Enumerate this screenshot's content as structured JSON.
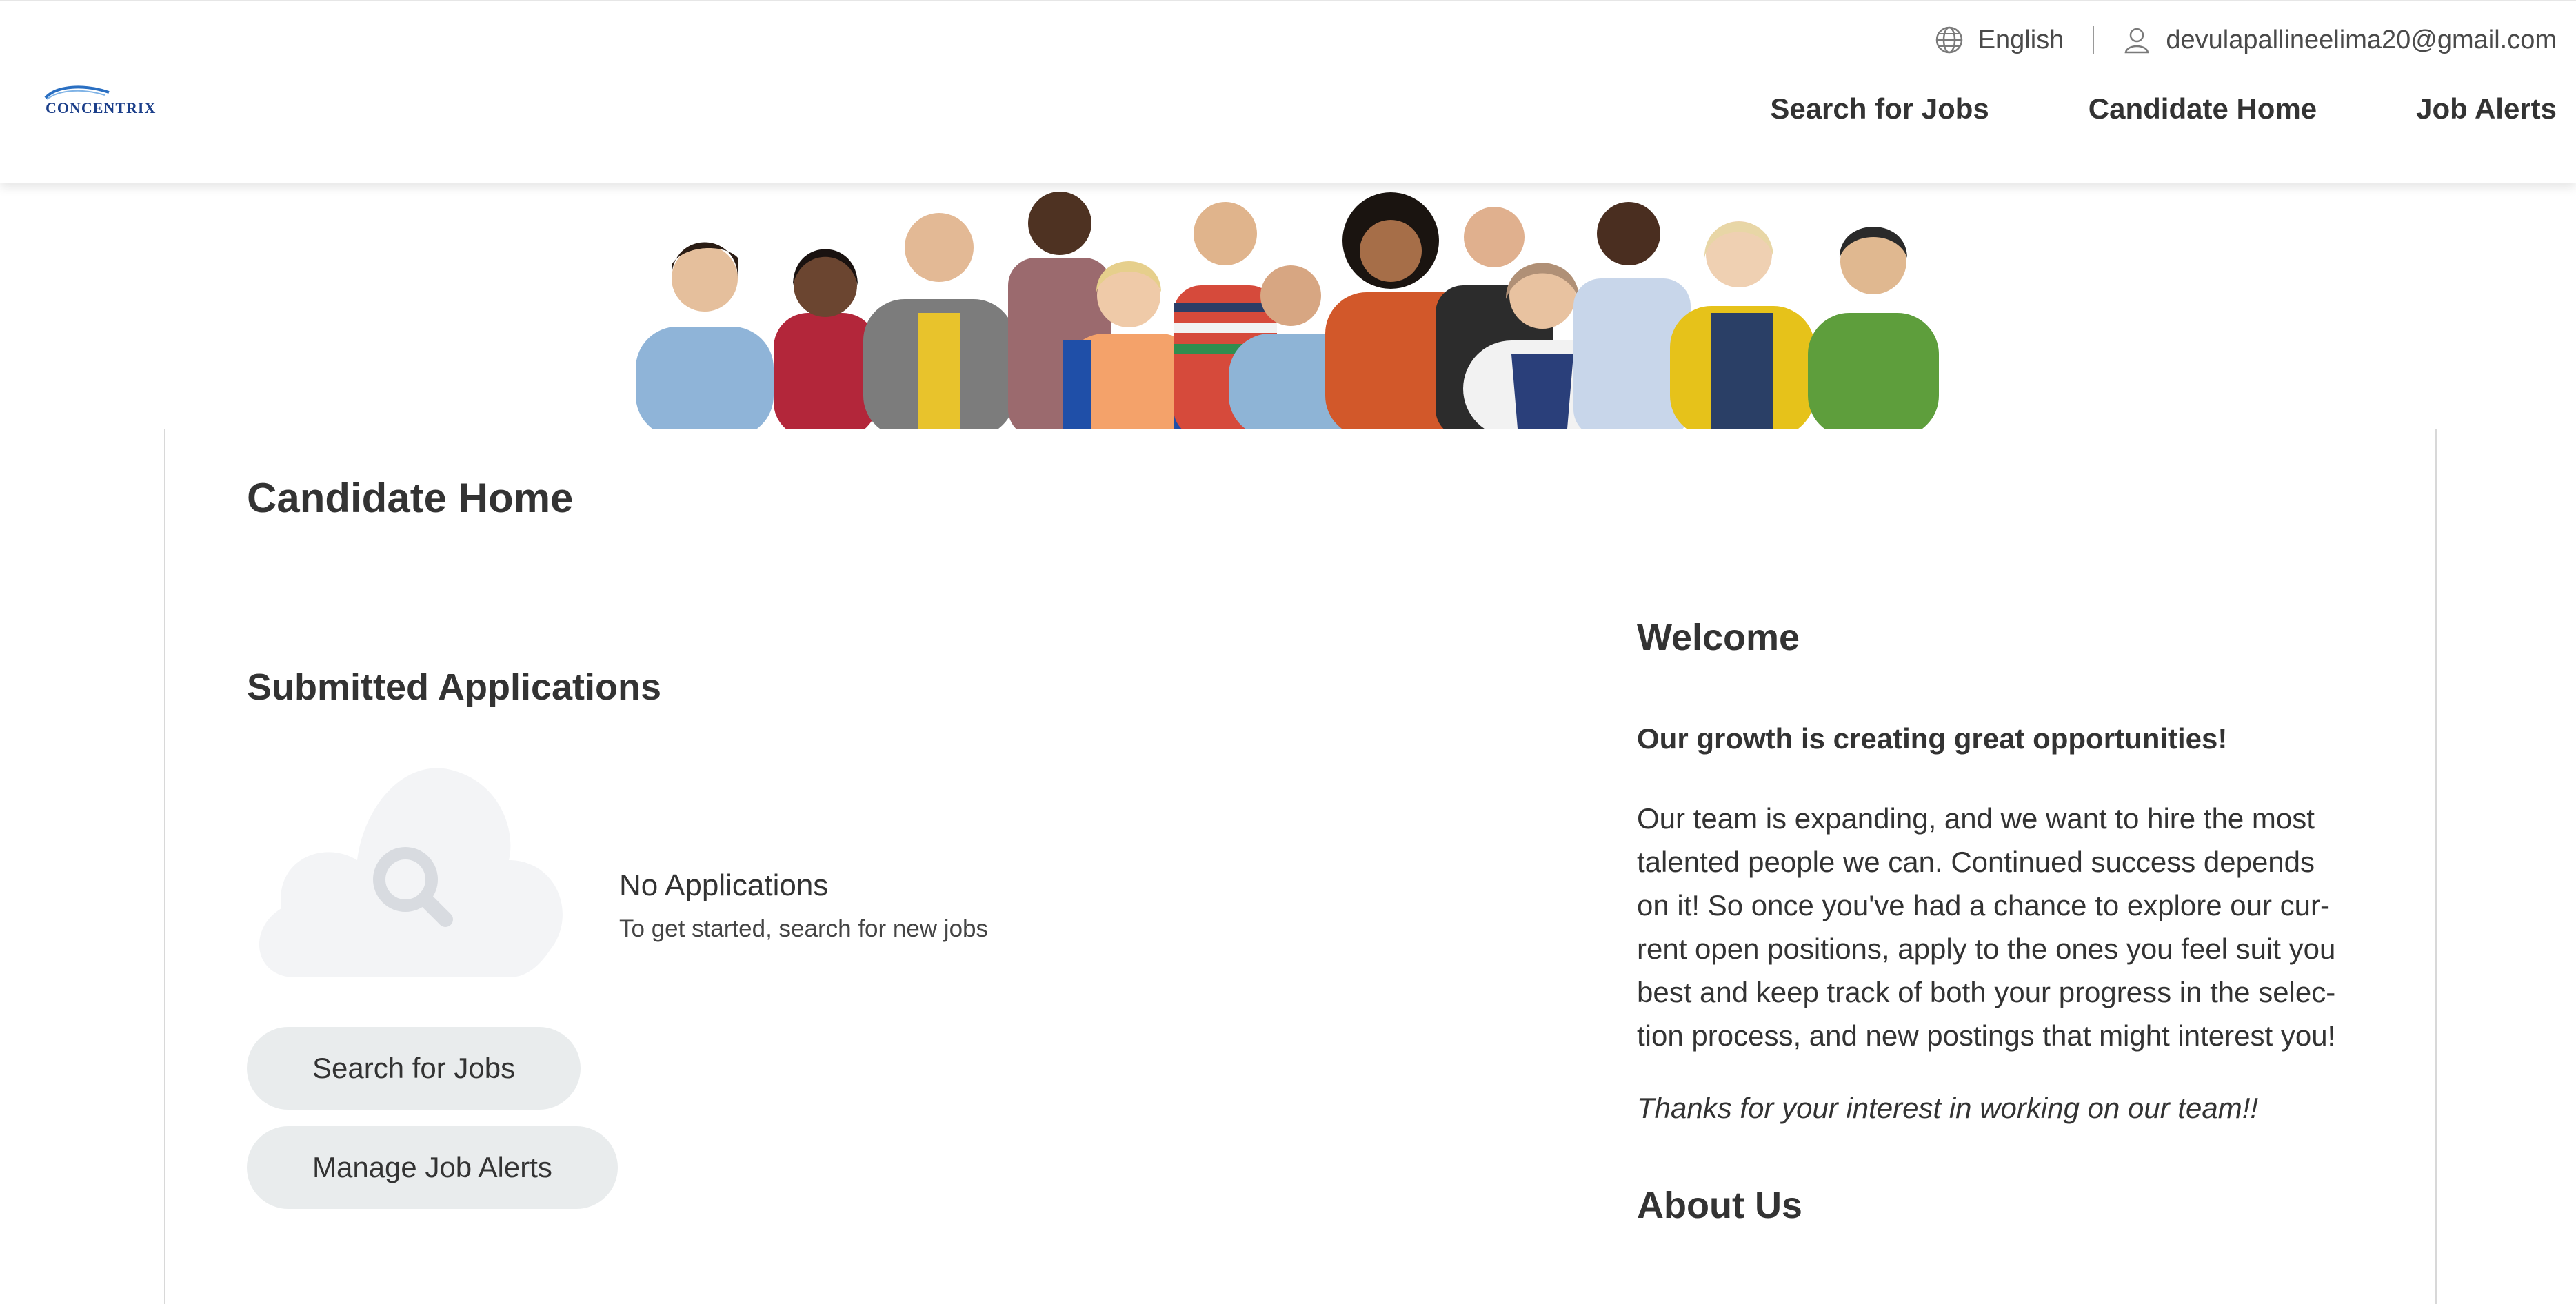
{
  "brand": {
    "logo_text": "CONCENTRIX",
    "logo_color": "#1c3f8a"
  },
  "utility": {
    "language_icon": "globe-icon",
    "language": "English",
    "account_icon": "user-icon",
    "email": "devulapallineelima20@gmail.com"
  },
  "nav": {
    "items": [
      {
        "label": "Search for Jobs"
      },
      {
        "label": "Candidate Home"
      },
      {
        "label": "Job Alerts"
      }
    ]
  },
  "banner": {
    "description_icon": "team-photo-banner"
  },
  "page": {
    "title": "Candidate Home"
  },
  "applications": {
    "title": "Submitted Applications",
    "empty_icon": "cloud-search-icon",
    "empty_title": "No Applications",
    "empty_subtitle": "To get started, search for new jobs",
    "search_button": "Search for Jobs",
    "alerts_button": "Manage Job Alerts"
  },
  "welcome": {
    "title": "Welcome",
    "headline": "Our growth is creating great opportunities!",
    "body_lines": [
      "Our team is expanding, and we want to hire the most",
      "talented people we can. Continued success depends",
      "on it! So once you've had a chance to explore our cur-",
      "rent open positions, apply to the ones you feel suit you",
      "best and keep track of both your progress in the selec-",
      "tion process, and new postings that might interest you!"
    ],
    "closing": "Thanks for your interest in working on our team!!"
  },
  "about": {
    "title": "About Us"
  },
  "colors": {
    "text": "#333333",
    "pill_bg": "#e9eced",
    "cloud": "#f3f4f6",
    "magnifier": "#d8dbe0",
    "card_border": "#d8d8d8"
  }
}
